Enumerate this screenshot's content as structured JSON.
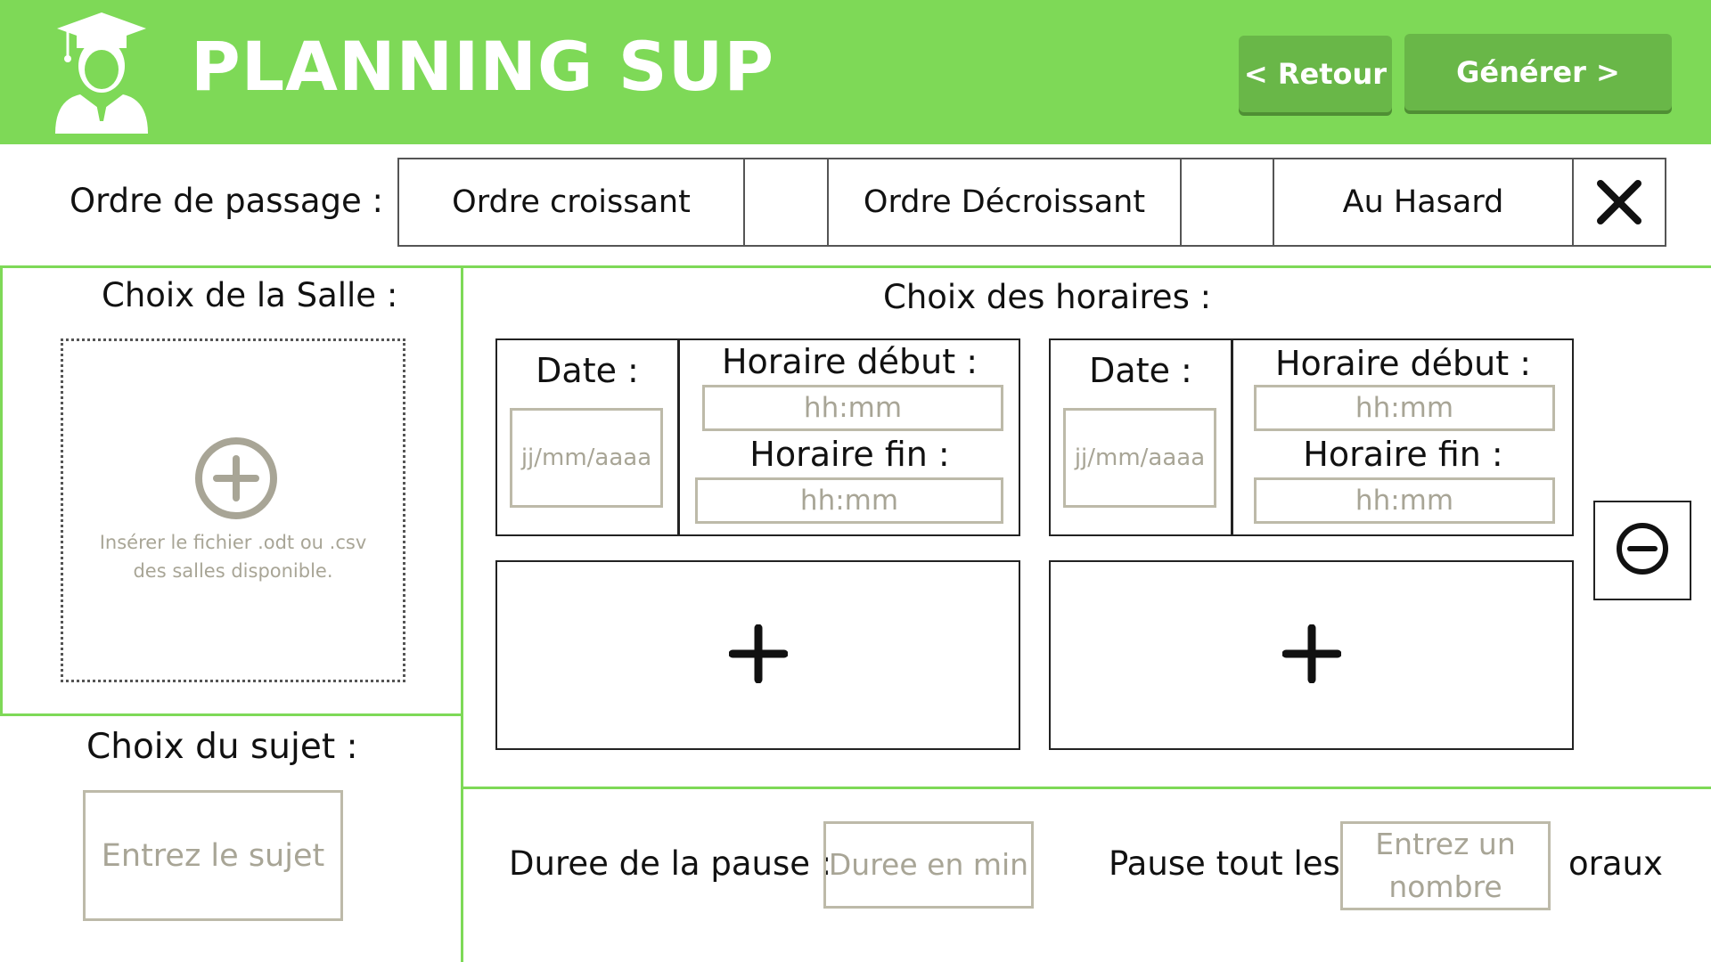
{
  "header": {
    "app_title": "PLANNING SUP",
    "back_button": "< Retour",
    "generate_button": "Générer >",
    "logo_icon": "graduate-student-icon"
  },
  "order": {
    "label": "Ordre de passage :",
    "options": [
      "Ordre croissant",
      "Ordre Décroissant",
      "Au Hasard"
    ],
    "clear_icon": "close-icon"
  },
  "room": {
    "title": "Choix de la Salle :",
    "dropzone_text_line1": "Insérer le fichier .odt ou .csv",
    "dropzone_text_line2": "des salles disponible.",
    "dropzone_icon": "plus-circle-icon"
  },
  "subject": {
    "title": "Choix du sujet :",
    "placeholder": "Entrez le sujet"
  },
  "schedule": {
    "title": "Choix des horaires :",
    "cards": [
      {
        "date_label": "Date :",
        "date_placeholder": "jj/mm/aaaa",
        "start_label": "Horaire début :",
        "start_placeholder": "hh:mm",
        "end_label": "Horaire fin :",
        "end_placeholder": "hh:mm"
      },
      {
        "date_label": "Date :",
        "date_placeholder": "jj/mm/aaaa",
        "start_label": "Horaire début :",
        "start_placeholder": "hh:mm",
        "end_label": "Horaire fin :",
        "end_placeholder": "hh:mm"
      }
    ],
    "add_icon": "plus-icon",
    "remove_icon": "minus-circle-icon"
  },
  "pause": {
    "duration_label": "Duree de la pause :",
    "duration_placeholder": "Duree en min",
    "every_label": "Pause tout les",
    "every_placeholder_line1": "Entrez un",
    "every_placeholder_line2": "nombre",
    "every_suffix": "oraux"
  },
  "colors": {
    "header_green": "#7ed957",
    "button_green": "#69b748",
    "placeholder_grey": "#a8a596",
    "input_border": "#bdbaa9"
  }
}
